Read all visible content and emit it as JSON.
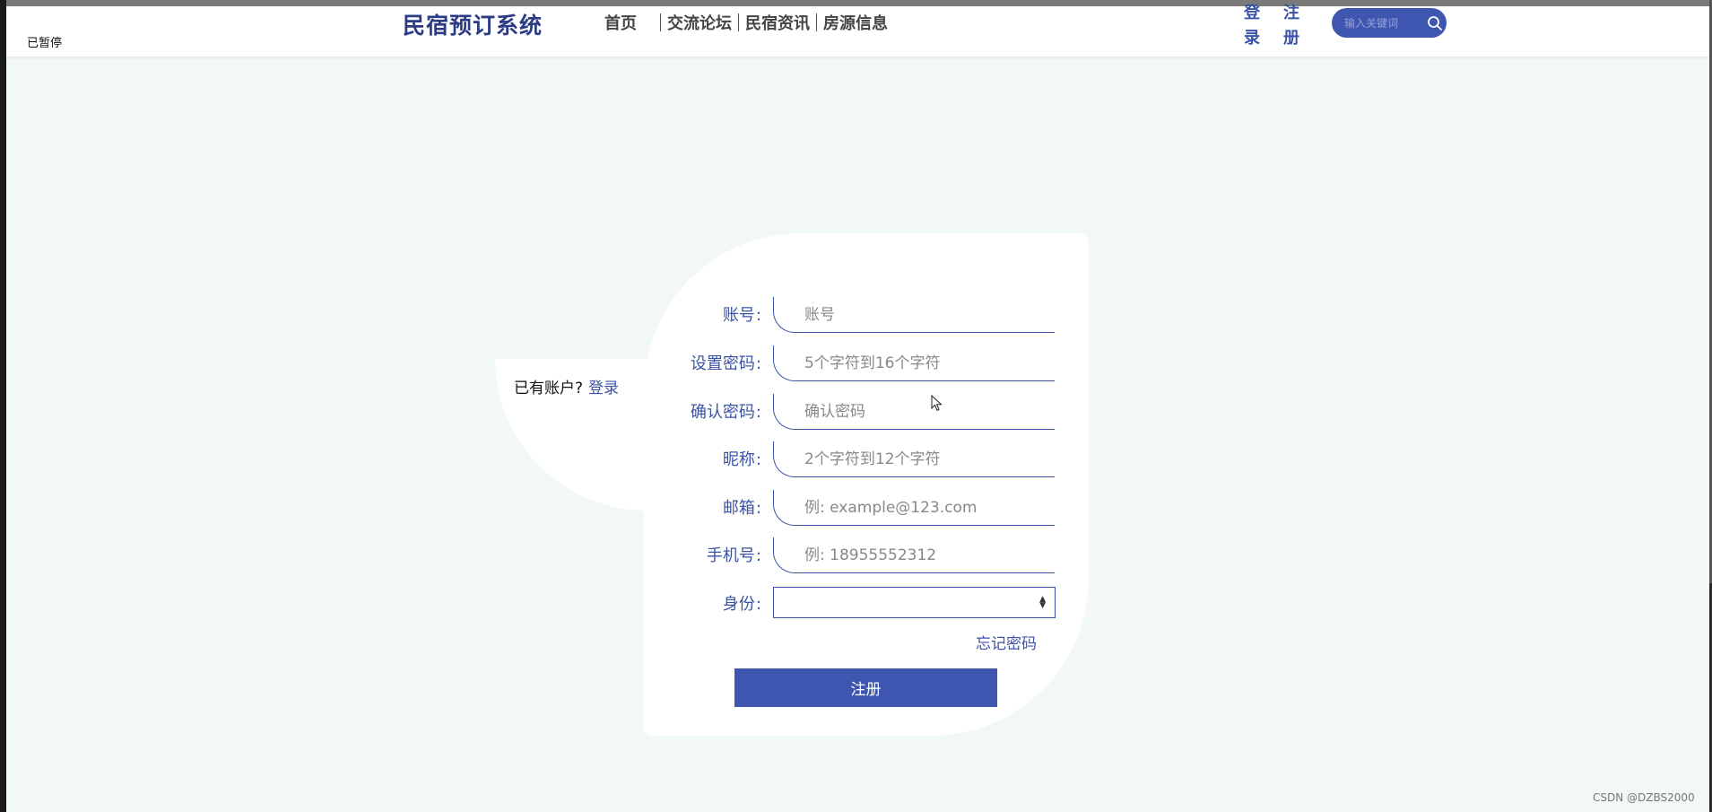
{
  "header": {
    "status": "已暂停",
    "brand": "民宿预订系统",
    "nav": [
      "首页",
      "交流论坛",
      "民宿资讯",
      "房源信息"
    ],
    "login": [
      "登",
      "录"
    ],
    "register": [
      "注",
      "册"
    ],
    "search_placeholder": "输入关键词"
  },
  "side": {
    "text": "已有账户?",
    "link": "登录"
  },
  "form": {
    "fields": [
      {
        "label": "账号",
        "placeholder": "账号"
      },
      {
        "label": "设置密码",
        "placeholder": "5个字符到16个字符"
      },
      {
        "label": "确认密码",
        "placeholder": "确认密码"
      },
      {
        "label": "昵称",
        "placeholder": "2个字符到12个字符"
      },
      {
        "label": "邮箱",
        "placeholder": "例: example@123.com"
      },
      {
        "label": "手机号",
        "placeholder": "例: 18955552312"
      }
    ],
    "identity_label": "身份",
    "identity_value": "",
    "forgot": "忘记密码",
    "submit": "注册"
  },
  "watermark": "CSDN @DZBS2000",
  "colors": {
    "accent": "#3f56b0",
    "label": "#3b53a6",
    "background": "#f2f7f7"
  }
}
